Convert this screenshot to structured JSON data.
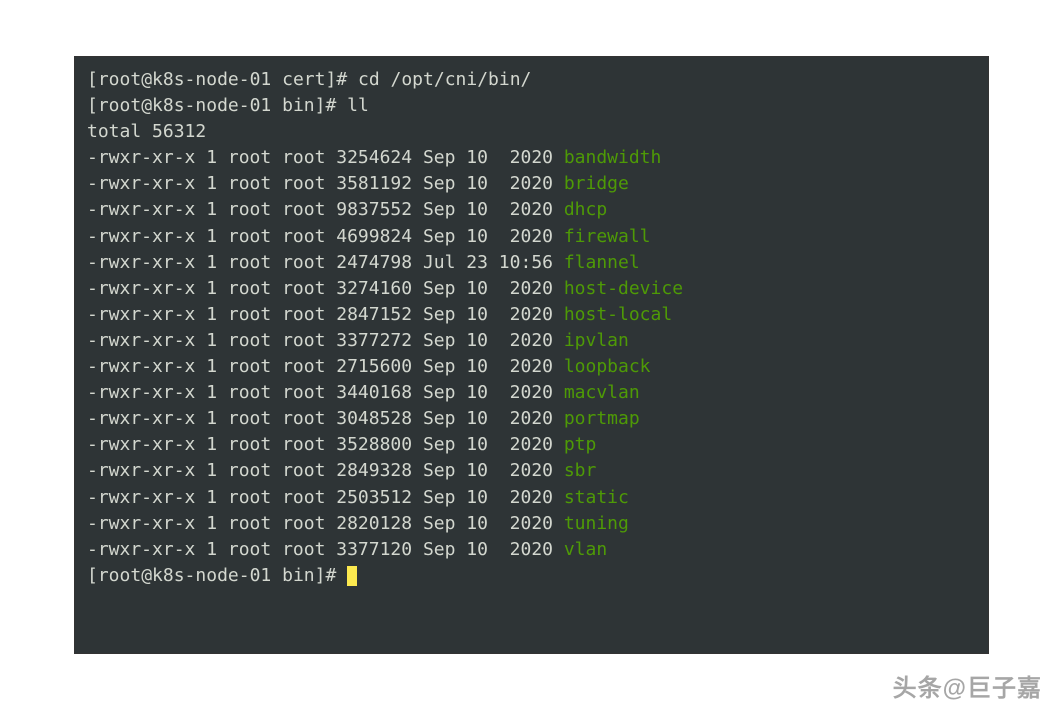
{
  "prompt1": {
    "user": "root",
    "host": "k8s-node-01",
    "cwd": "cert",
    "symbol": "#",
    "command": "cd /opt/cni/bin/"
  },
  "prompt2": {
    "user": "root",
    "host": "k8s-node-01",
    "cwd": "bin",
    "symbol": "#",
    "command": "ll"
  },
  "total_line": "total 56312",
  "files": [
    {
      "perms": "-rwxr-xr-x",
      "links": "1",
      "owner": "root",
      "group": "root",
      "size": "3254624",
      "month": "Sep",
      "day": "10",
      "timeyear": " 2020",
      "name": "bandwidth"
    },
    {
      "perms": "-rwxr-xr-x",
      "links": "1",
      "owner": "root",
      "group": "root",
      "size": "3581192",
      "month": "Sep",
      "day": "10",
      "timeyear": " 2020",
      "name": "bridge"
    },
    {
      "perms": "-rwxr-xr-x",
      "links": "1",
      "owner": "root",
      "group": "root",
      "size": "9837552",
      "month": "Sep",
      "day": "10",
      "timeyear": " 2020",
      "name": "dhcp"
    },
    {
      "perms": "-rwxr-xr-x",
      "links": "1",
      "owner": "root",
      "group": "root",
      "size": "4699824",
      "month": "Sep",
      "day": "10",
      "timeyear": " 2020",
      "name": "firewall"
    },
    {
      "perms": "-rwxr-xr-x",
      "links": "1",
      "owner": "root",
      "group": "root",
      "size": "2474798",
      "month": "Jul",
      "day": "23",
      "timeyear": "10:56",
      "name": "flannel"
    },
    {
      "perms": "-rwxr-xr-x",
      "links": "1",
      "owner": "root",
      "group": "root",
      "size": "3274160",
      "month": "Sep",
      "day": "10",
      "timeyear": " 2020",
      "name": "host-device"
    },
    {
      "perms": "-rwxr-xr-x",
      "links": "1",
      "owner": "root",
      "group": "root",
      "size": "2847152",
      "month": "Sep",
      "day": "10",
      "timeyear": " 2020",
      "name": "host-local"
    },
    {
      "perms": "-rwxr-xr-x",
      "links": "1",
      "owner": "root",
      "group": "root",
      "size": "3377272",
      "month": "Sep",
      "day": "10",
      "timeyear": " 2020",
      "name": "ipvlan"
    },
    {
      "perms": "-rwxr-xr-x",
      "links": "1",
      "owner": "root",
      "group": "root",
      "size": "2715600",
      "month": "Sep",
      "day": "10",
      "timeyear": " 2020",
      "name": "loopback"
    },
    {
      "perms": "-rwxr-xr-x",
      "links": "1",
      "owner": "root",
      "group": "root",
      "size": "3440168",
      "month": "Sep",
      "day": "10",
      "timeyear": " 2020",
      "name": "macvlan"
    },
    {
      "perms": "-rwxr-xr-x",
      "links": "1",
      "owner": "root",
      "group": "root",
      "size": "3048528",
      "month": "Sep",
      "day": "10",
      "timeyear": " 2020",
      "name": "portmap"
    },
    {
      "perms": "-rwxr-xr-x",
      "links": "1",
      "owner": "root",
      "group": "root",
      "size": "3528800",
      "month": "Sep",
      "day": "10",
      "timeyear": " 2020",
      "name": "ptp"
    },
    {
      "perms": "-rwxr-xr-x",
      "links": "1",
      "owner": "root",
      "group": "root",
      "size": "2849328",
      "month": "Sep",
      "day": "10",
      "timeyear": " 2020",
      "name": "sbr"
    },
    {
      "perms": "-rwxr-xr-x",
      "links": "1",
      "owner": "root",
      "group": "root",
      "size": "2503512",
      "month": "Sep",
      "day": "10",
      "timeyear": " 2020",
      "name": "static"
    },
    {
      "perms": "-rwxr-xr-x",
      "links": "1",
      "owner": "root",
      "group": "root",
      "size": "2820128",
      "month": "Sep",
      "day": "10",
      "timeyear": " 2020",
      "name": "tuning"
    },
    {
      "perms": "-rwxr-xr-x",
      "links": "1",
      "owner": "root",
      "group": "root",
      "size": "3377120",
      "month": "Sep",
      "day": "10",
      "timeyear": " 2020",
      "name": "vlan"
    }
  ],
  "prompt3": {
    "user": "root",
    "host": "k8s-node-01",
    "cwd": "bin",
    "symbol": "#"
  },
  "watermark": "头条@巨子嘉"
}
